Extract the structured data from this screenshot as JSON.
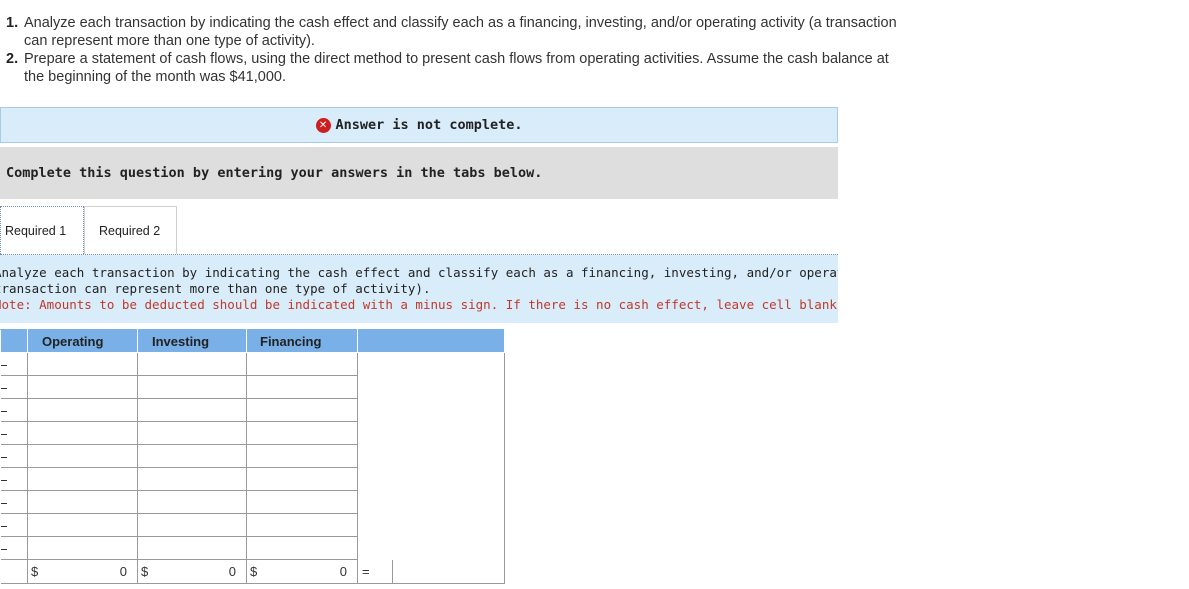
{
  "instructions": [
    {
      "num": "1.",
      "text": "Analyze each transaction by indicating the cash effect and classify each as a financing, investing, and/or operating activity (a transaction can represent more than one type of activity)."
    },
    {
      "num": "2.",
      "text": "Prepare a statement of cash flows, using the direct method to present cash flows from operating activities. Assume the cash balance at the beginning of the month was $41,000."
    }
  ],
  "status_banner": {
    "icon": "x-circle-icon",
    "text": "Answer is not complete.",
    "icon_color": "#cc1f1f"
  },
  "complete_prompt": "Complete this question by entering your answers in the tabs below.",
  "tabs": [
    {
      "label": "Required 1",
      "active": true
    },
    {
      "label": "Required 2",
      "active": false
    }
  ],
  "question": {
    "line1": "Analyze each transaction by indicating the cash effect and classify each as a financing, investing, and/or operating activity (a",
    "line2": "transaction can represent more than one type of activity).",
    "note": "Note: Amounts to be deducted should be indicated with a minus sign. If there is no cash effect, leave cell blank."
  },
  "table": {
    "headers": [
      "Operating",
      "Investing",
      "Financing"
    ],
    "row_count": 9,
    "totals": [
      {
        "symbol": "$",
        "value": "0"
      },
      {
        "symbol": "$",
        "value": "0"
      },
      {
        "symbol": "$",
        "value": "0"
      }
    ],
    "equals": "="
  },
  "colors": {
    "header_bg": "#7ab0e8",
    "info_bg": "#d9ecf9",
    "note_text": "#c0392b"
  }
}
